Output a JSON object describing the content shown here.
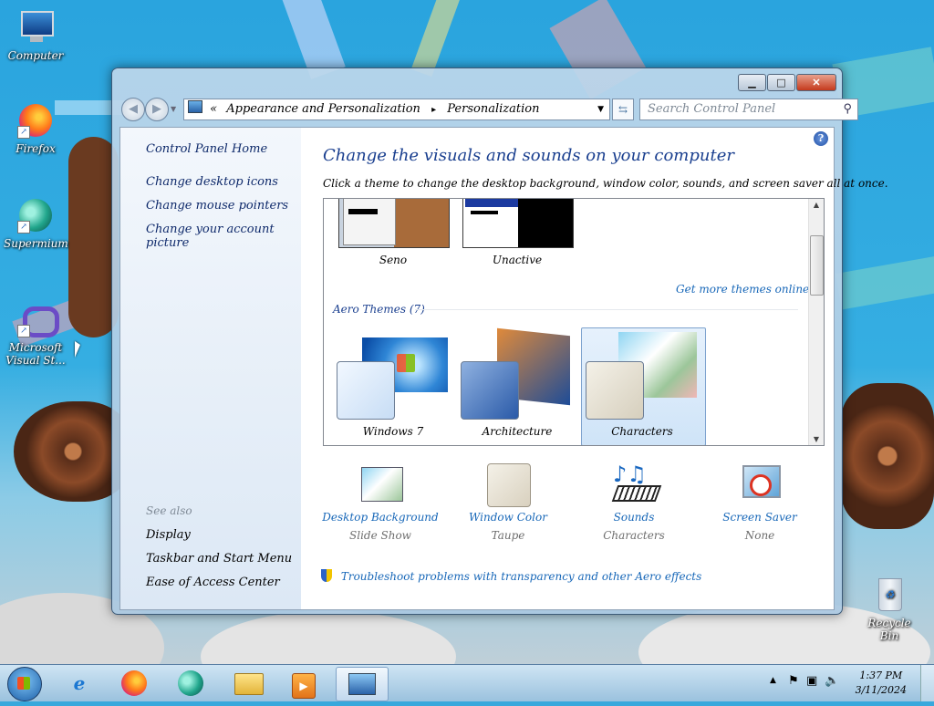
{
  "desktop": {
    "icons": [
      {
        "label": "Computer"
      },
      {
        "label": "Firefox"
      },
      {
        "label": "Supermium"
      },
      {
        "label": "Microsoft Visual St..."
      },
      {
        "label": "Recycle Bin"
      }
    ]
  },
  "window": {
    "address": {
      "prefix": "«",
      "crumb1": "Appearance and Personalization",
      "sep": "▸",
      "crumb2": "Personalization"
    },
    "search_placeholder": "Search Control Panel",
    "left_pane": {
      "home": "Control Panel Home",
      "links": [
        "Change desktop icons",
        "Change mouse pointers",
        "Change your account picture"
      ],
      "see_also_title": "See also",
      "see_also": [
        "Display",
        "Taskbar and Start Menu",
        "Ease of Access Center"
      ]
    },
    "heading": "Change the visuals and sounds on your computer",
    "subheading": "Click a theme to change the desktop background, window color, sounds, and screen saver all at once.",
    "themes": {
      "basic": [
        {
          "name": "Seno"
        },
        {
          "name": "Unactive"
        }
      ],
      "more_online": "Get more themes online",
      "group_title": "Aero Themes (7)",
      "aero": [
        {
          "name": "Windows 7"
        },
        {
          "name": "Architecture"
        },
        {
          "name": "Characters"
        }
      ]
    },
    "settings": [
      {
        "label": "Desktop Background",
        "value": "Slide Show"
      },
      {
        "label": "Window Color",
        "value": "Taupe"
      },
      {
        "label": "Sounds",
        "value": "Characters"
      },
      {
        "label": "Screen Saver",
        "value": "None"
      }
    ],
    "troubleshoot": "Troubleshoot problems with transparency and other Aero effects"
  },
  "taskbar": {
    "time": "1:37 PM",
    "date": "3/11/2024"
  }
}
